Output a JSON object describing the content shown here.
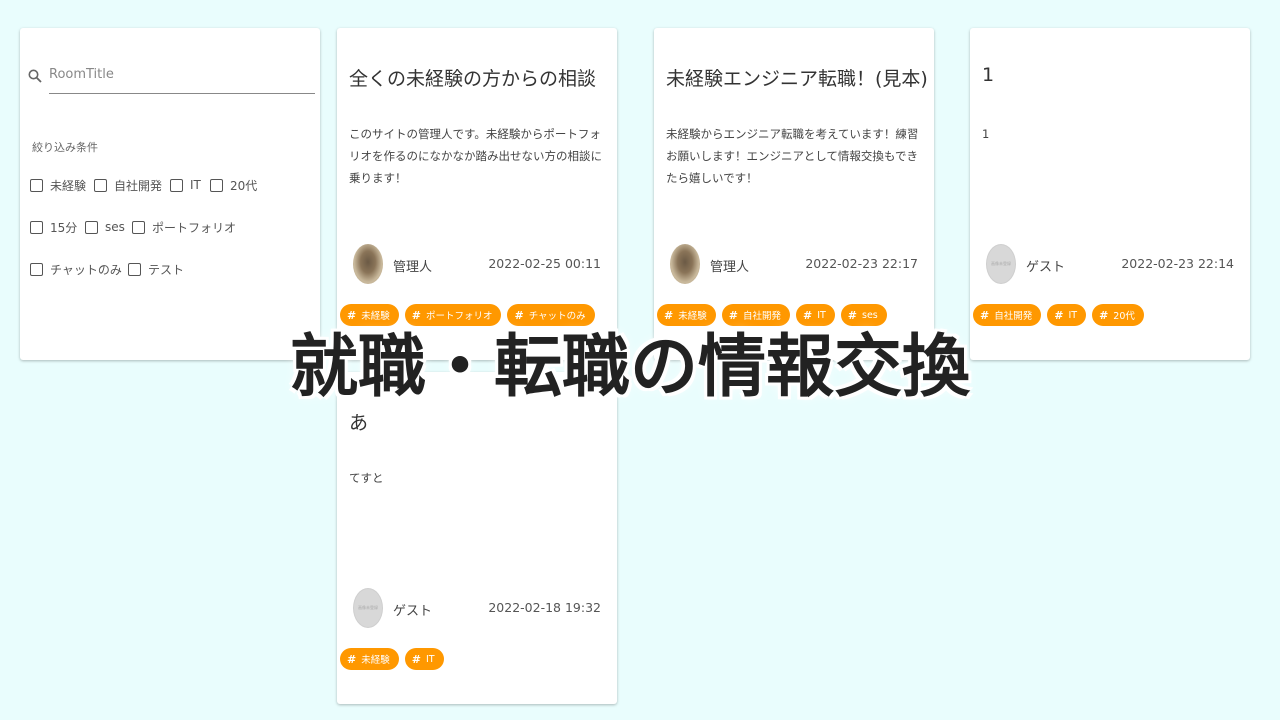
{
  "search": {
    "placeholder": "RoomTitle",
    "icon": "search-icon"
  },
  "filter": {
    "label": "絞り込み条件",
    "options": [
      "未経験",
      "自社開発",
      "IT",
      "20代",
      "15分",
      "ses",
      "ポートフォリオ",
      "チャットのみ",
      "テスト"
    ]
  },
  "rooms": [
    {
      "title": "全くの未経験の方からの相談",
      "description": "このサイトの管理人です。未経験からポートフォリオを作るのになかなか踏み出せない方の相談に乗ります！",
      "user": "管理人",
      "date": "2022-02-25 00:11",
      "avatar": "photo",
      "tags": [
        "未経験",
        "ポートフォリオ",
        "チャットのみ"
      ]
    },
    {
      "title": "未経験エンジニア転職！(見本)",
      "description": "未経験からエンジニア転職を考えています！練習お願いします！エンジニアとして情報交換もできたら嬉しいです！",
      "user": "管理人",
      "date": "2022-02-23 22:17",
      "avatar": "photo",
      "tags": [
        "未経験",
        "自社開発",
        "IT",
        "ses"
      ]
    },
    {
      "title": "1",
      "description": "1",
      "user": "ゲスト",
      "date": "2022-02-23 22:14",
      "avatar": "guest",
      "tags": [
        "自社開発",
        "IT",
        "20代"
      ]
    },
    {
      "title": "あ",
      "description": "てすと",
      "user": "ゲスト",
      "date": "2022-02-18 19:32",
      "avatar": "guest",
      "tags": [
        "未経験",
        "IT"
      ]
    }
  ],
  "overlay": {
    "title": "就職・転職の情報交換"
  },
  "colors": {
    "background": "#e9fdfd",
    "tag": "#ff9800",
    "card": "#ffffff"
  }
}
